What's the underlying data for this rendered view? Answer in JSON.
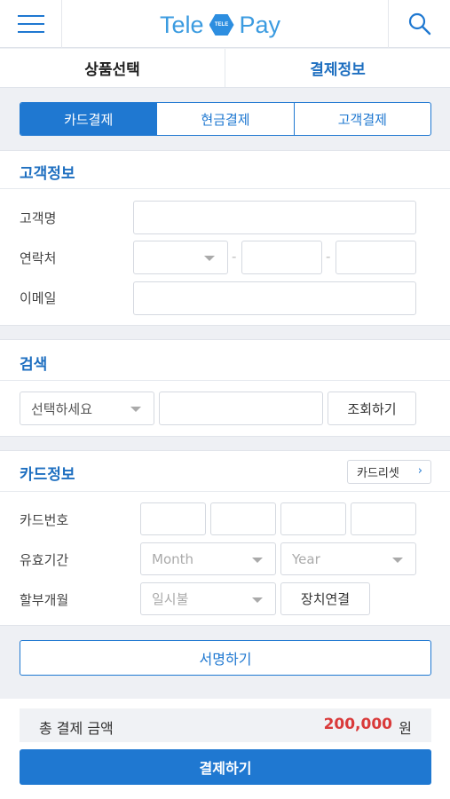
{
  "header": {
    "logo_left": "Tele",
    "logo_badge": "TELE",
    "logo_right": "Pay",
    "accent_color": "#1f78d1"
  },
  "main_tabs": [
    {
      "label": "상품선택",
      "active": false
    },
    {
      "label": "결제정보",
      "active": true
    }
  ],
  "pay_tabs": [
    {
      "label": "카드결제",
      "active": true
    },
    {
      "label": "현금결제",
      "active": false
    },
    {
      "label": "고객결제",
      "active": false
    }
  ],
  "customer": {
    "title": "고객정보",
    "name_label": "고객명",
    "phone_label": "연락처",
    "phone_sep": "-",
    "email_label": "이메일"
  },
  "search": {
    "title": "검색",
    "select_value": "선택하세요",
    "query_button": "조회하기"
  },
  "card": {
    "title": "카드정보",
    "reset_button": "카드리셋",
    "number_label": "카드번호",
    "expiry_label": "유효기간",
    "month_placeholder": "Month",
    "year_placeholder": "Year",
    "installment_label": "할부개월",
    "installment_value": "일시불",
    "device_button": "장치연결"
  },
  "signature_button": "서명하기",
  "total": {
    "label": "총 결제 금액",
    "amount": "200,000",
    "unit": "원",
    "amount_color": "#d93a3a"
  },
  "pay_button": "결제하기"
}
